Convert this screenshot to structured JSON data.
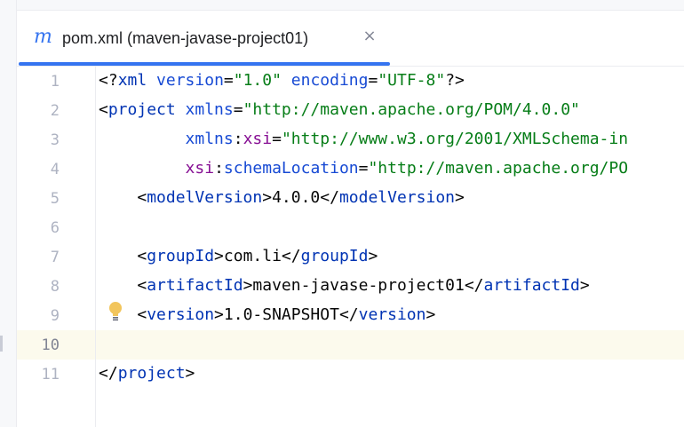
{
  "tab": {
    "icon_glyph": "m",
    "icon_name": "maven-file-icon",
    "label": "pom.xml (maven-javase-project01)",
    "close_glyph": "×",
    "accent_color": "#3574f0"
  },
  "editor": {
    "current_line": 10,
    "lines": [
      {
        "number": "1",
        "tokens": [
          {
            "c": "t-punct",
            "t": "<?"
          },
          {
            "c": "t-tag",
            "t": "xml"
          },
          {
            "c": "t-punct",
            "t": " "
          },
          {
            "c": "t-attr",
            "t": "version"
          },
          {
            "c": "t-punct",
            "t": "="
          },
          {
            "c": "t-str",
            "t": "\"1.0\""
          },
          {
            "c": "t-punct",
            "t": " "
          },
          {
            "c": "t-attr",
            "t": "encoding"
          },
          {
            "c": "t-punct",
            "t": "="
          },
          {
            "c": "t-str",
            "t": "\"UTF-8\""
          },
          {
            "c": "t-punct",
            "t": "?>"
          }
        ]
      },
      {
        "number": "2",
        "tokens": [
          {
            "c": "t-punct",
            "t": "<"
          },
          {
            "c": "t-tag",
            "t": "project"
          },
          {
            "c": "t-punct",
            "t": " "
          },
          {
            "c": "t-attr",
            "t": "xmlns"
          },
          {
            "c": "t-punct",
            "t": "="
          },
          {
            "c": "t-str",
            "t": "\"http://maven.apache.org/POM/4.0.0\""
          }
        ]
      },
      {
        "number": "3",
        "tokens": [
          {
            "c": "t-punct",
            "t": "         "
          },
          {
            "c": "t-attr",
            "t": "xmlns"
          },
          {
            "c": "t-punct",
            "t": ":"
          },
          {
            "c": "t-ns",
            "t": "xsi"
          },
          {
            "c": "t-punct",
            "t": "="
          },
          {
            "c": "t-str",
            "t": "\"http://www.w3.org/2001/XMLSchema-in"
          }
        ]
      },
      {
        "number": "4",
        "tokens": [
          {
            "c": "t-punct",
            "t": "         "
          },
          {
            "c": "t-ns",
            "t": "xsi"
          },
          {
            "c": "t-punct",
            "t": ":"
          },
          {
            "c": "t-attr",
            "t": "schemaLocation"
          },
          {
            "c": "t-punct",
            "t": "="
          },
          {
            "c": "t-str",
            "t": "\"http://maven.apache.org/PO"
          }
        ]
      },
      {
        "number": "5",
        "tokens": [
          {
            "c": "t-punct",
            "t": "    <"
          },
          {
            "c": "t-tag",
            "t": "modelVersion"
          },
          {
            "c": "t-punct",
            "t": ">"
          },
          {
            "c": "t-text",
            "t": "4.0.0"
          },
          {
            "c": "t-punct",
            "t": "</"
          },
          {
            "c": "t-tag",
            "t": "modelVersion"
          },
          {
            "c": "t-punct",
            "t": ">"
          }
        ]
      },
      {
        "number": "6",
        "tokens": []
      },
      {
        "number": "7",
        "tokens": [
          {
            "c": "t-punct",
            "t": "    <"
          },
          {
            "c": "t-tag",
            "t": "groupId"
          },
          {
            "c": "t-punct",
            "t": ">"
          },
          {
            "c": "t-text",
            "t": "com.li"
          },
          {
            "c": "t-punct",
            "t": "</"
          },
          {
            "c": "t-tag",
            "t": "groupId"
          },
          {
            "c": "t-punct",
            "t": ">"
          }
        ]
      },
      {
        "number": "8",
        "tokens": [
          {
            "c": "t-punct",
            "t": "    <"
          },
          {
            "c": "t-tag",
            "t": "artifactId"
          },
          {
            "c": "t-punct",
            "t": ">"
          },
          {
            "c": "t-text",
            "t": "maven-javase-project01"
          },
          {
            "c": "t-punct",
            "t": "</"
          },
          {
            "c": "t-tag",
            "t": "artifactId"
          },
          {
            "c": "t-punct",
            "t": ">"
          }
        ]
      },
      {
        "number": "9",
        "tokens": [
          {
            "c": "t-punct",
            "t": "    <"
          },
          {
            "c": "t-tag",
            "t": "version"
          },
          {
            "c": "t-punct",
            "t": ">"
          },
          {
            "c": "t-text",
            "t": "1.0-SNAPSHOT"
          },
          {
            "c": "t-punct",
            "t": "</"
          },
          {
            "c": "t-tag",
            "t": "version"
          },
          {
            "c": "t-punct",
            "t": ">"
          }
        ]
      },
      {
        "number": "10",
        "tokens": []
      },
      {
        "number": "11",
        "tokens": [
          {
            "c": "t-punct",
            "t": "</"
          },
          {
            "c": "t-tag",
            "t": "project"
          },
          {
            "c": "t-punct",
            "t": ">"
          }
        ]
      }
    ]
  },
  "intention_bulb": {
    "icon_name": "lightbulb-icon",
    "line": 9,
    "color": "#f2c55c"
  }
}
